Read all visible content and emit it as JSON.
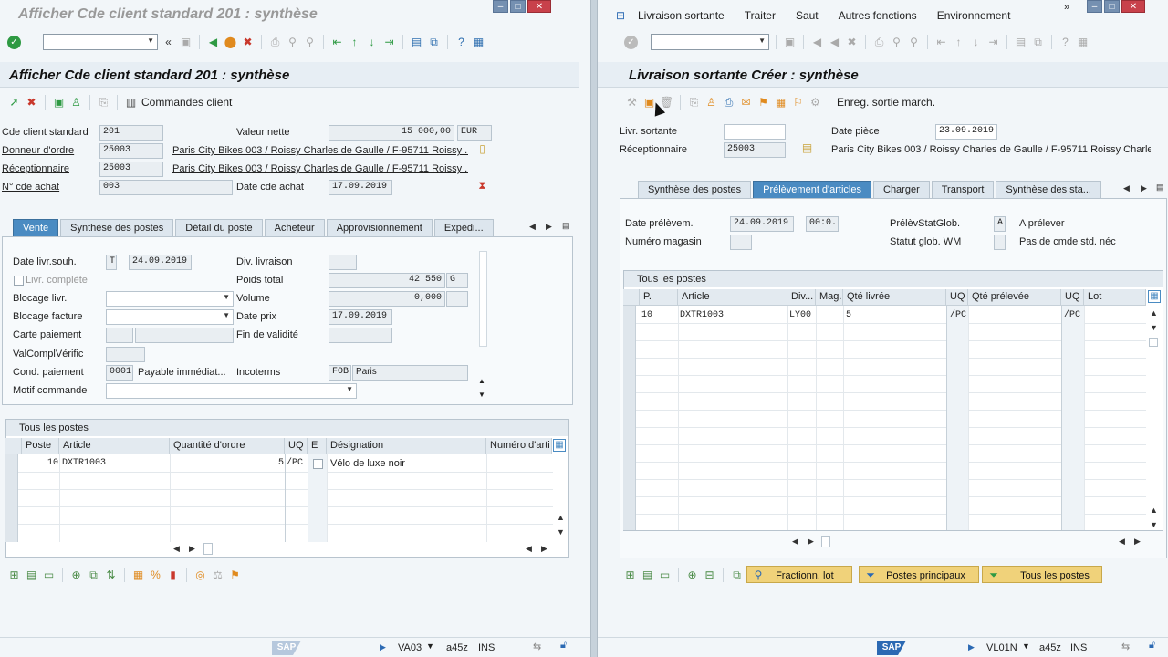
{
  "left": {
    "window_title": "Afficher Cde client standard 201 : synthèse",
    "screen_title": "Afficher Cde client standard 201 : synthèse",
    "app_toolbar": {
      "orders_label": "Commandes client"
    },
    "header_fields": {
      "doc_label": "Cde client standard",
      "doc_value": "201",
      "net_value_label": "Valeur nette",
      "net_value": "15 000,00",
      "currency": "EUR",
      "sold_to_label": "Donneur d'ordre",
      "sold_to_value": "25003",
      "sold_to_desc": "Paris City Bikes 003 / Roissy Charles de Gaulle / F-95711 Roissy ...",
      "ship_to_label": "Réceptionnaire",
      "ship_to_value": "25003",
      "ship_to_desc": "Paris City Bikes 003 / Roissy Charles de Gaulle / F-95711 Roissy ...",
      "po_label": "N° cde achat",
      "po_value": "003",
      "po_date_label": "Date cde achat",
      "po_date_value": "17.09.2019"
    },
    "tabs": [
      "Vente",
      "Synthèse des postes",
      "Détail du poste",
      "Acheteur",
      "Approvisionnement",
      "Expédi..."
    ],
    "sales": {
      "req_date_label": "Date livr.souh.",
      "req_date_type": "T",
      "req_date_value": "24.09.2019",
      "del_plant_label": "Div. livraison",
      "del_plant_value": "",
      "complete_label": "Livr. complète",
      "total_weight_label": "Poids total",
      "total_weight_value": "42 550",
      "weight_unit": "G",
      "del_block_label": "Blocage livr.",
      "volume_label": "Volume",
      "volume_value": "0,000",
      "bill_block_label": "Blocage facture",
      "pricing_date_label": "Date prix",
      "pricing_date_value": "17.09.2019",
      "card_label": "Carte paiement",
      "validity_label": "Fin de validité",
      "cardcheck_label": "ValComplVérific",
      "terms_label": "Cond. paiement",
      "terms_value": "0001",
      "terms_desc": "Payable immédiat...",
      "incoterms_label": "Incoterms",
      "incoterms_value": "FOB",
      "incoterms_place": "Paris",
      "reason_label": "Motif commande"
    },
    "items": {
      "group_title": "Tous les postes",
      "columns": [
        "Poste",
        "Article",
        "Quantité d'ordre",
        "UQ",
        "E",
        "Désignation",
        "Numéro d'arti"
      ],
      "rows": [
        {
          "item": "10",
          "material": "DXTR1003",
          "qty": "5",
          "uom": "/PC",
          "desc": "Vélo de luxe noir"
        }
      ]
    },
    "status": {
      "tcode": "VA03",
      "server": "a45z",
      "mode": "INS"
    }
  },
  "right": {
    "menu": [
      "Livraison sortante",
      "Traiter",
      "Saut",
      "Autres fonctions",
      "Environnement"
    ],
    "screen_title": "Livraison sortante  Créer : synthèse",
    "app_toolbar": {
      "goods_issue_label": "Enreg. sortie march."
    },
    "header_fields": {
      "delivery_label": "Livr. sortante",
      "delivery_value": "",
      "doc_date_label": "Date pièce",
      "doc_date_value": "23.09.2019",
      "ship_to_label": "Réceptionnaire",
      "ship_to_value": "25003",
      "ship_to_desc": "Paris City Bikes 003 / Roissy Charles de Gaulle / F-95711 Roissy Charle"
    },
    "tabs": [
      "Synthèse des postes",
      "Prélèvement d'articles",
      "Charger",
      "Transport",
      "Synthèse des sta..."
    ],
    "picking": {
      "pick_date_label": "Date prélèvem.",
      "pick_date_value": "24.09.2019",
      "pick_time_value": "00:0...",
      "pick_status_label": "PrélèvStatGlob.",
      "pick_status_value": "A",
      "pick_status_desc": "A prélever",
      "warehouse_label": "Numéro magasin",
      "wm_status_label": "Statut glob. WM",
      "wm_status_desc": "Pas de cmde std. néc"
    },
    "items": {
      "group_title": "Tous les postes",
      "columns": [
        "P.",
        "Article",
        "Div...",
        "Mag.",
        "Qté livrée",
        "UQ",
        "Qté prélevée",
        "UQ",
        "Lot"
      ],
      "rows": [
        {
          "item": "10",
          "material": "DXTR1003",
          "plant": "LY00",
          "delivered": "5",
          "uom1": "/PC",
          "uom2": "/PC"
        }
      ]
    },
    "buttons": {
      "split": "Fractionn. lot",
      "main_items": "Postes principaux",
      "all_items": "Tous les postes"
    },
    "status": {
      "tcode": "VL01N",
      "server": "a45z",
      "mode": "INS"
    }
  },
  "colors": {
    "accent_tab": "#4a8bc2",
    "ok_green": "#2e9a43",
    "sap_blue": "#2b69b3",
    "close_red": "#c8414b"
  }
}
